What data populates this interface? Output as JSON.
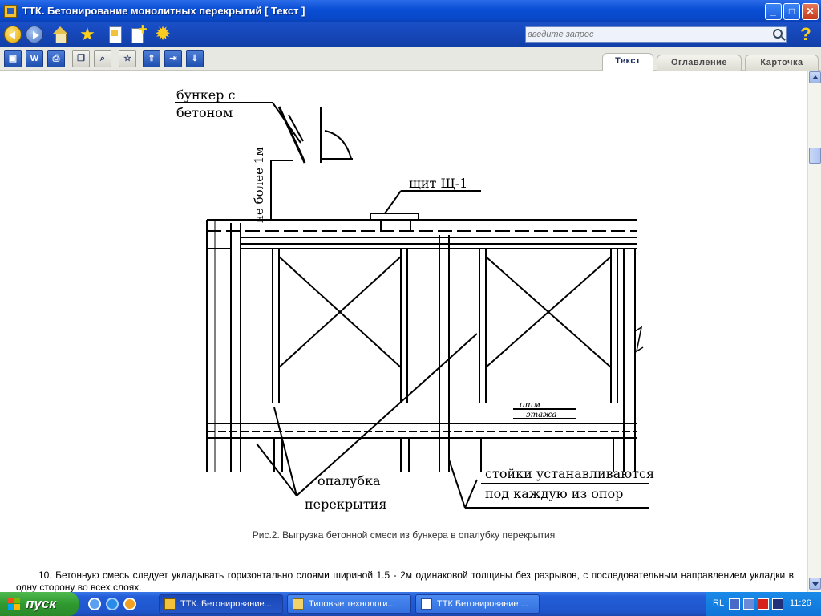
{
  "window": {
    "title": "ТТК. Бетонирование монолитных перекрытий [ Текст ]"
  },
  "search": {
    "placeholder": "введите запрос"
  },
  "tabs": [
    {
      "label": "Текст",
      "active": true
    },
    {
      "label": "Оглавление",
      "active": false
    },
    {
      "label": "Карточка",
      "active": false
    }
  ],
  "drawing": {
    "labels": {
      "bunker_line1": "бункер с",
      "bunker_line2": "бетоном",
      "height_note": "не более 1м",
      "shield": "щит Щ-1",
      "mark_line1": "отм",
      "mark_line2": "этажа",
      "formwork_line1": "опалубка",
      "formwork_line2": "перекрытия",
      "props_line1": "стойки устанавливаются",
      "props_line2": "под каждую из опор"
    }
  },
  "caption": "Рис.2. Выгрузка бетонной смеси из бункера в опалубку перекрытия",
  "paragraph": "10. Бетонную смесь следует укладывать горизонтально слоями шириной 1.5 - 2м одинаковой толщины без разрывов, с последовательным направлением укладки в одну сторону во всех слоях.",
  "taskbar": {
    "start_label": "пуск",
    "tasks": [
      {
        "label": "ТТК. Бетонирование...",
        "active": true
      },
      {
        "label": "Типовые технологи...",
        "active": false
      },
      {
        "label": "ТТК Бетонирование ...",
        "active": false
      }
    ],
    "language": "RL",
    "clock": "11:26"
  },
  "colors": {
    "titlebar": "#0a4fd6",
    "toolbar": "#1a4fc8",
    "start_button": "#2f9a2f",
    "taskbar": "#235ed8"
  }
}
